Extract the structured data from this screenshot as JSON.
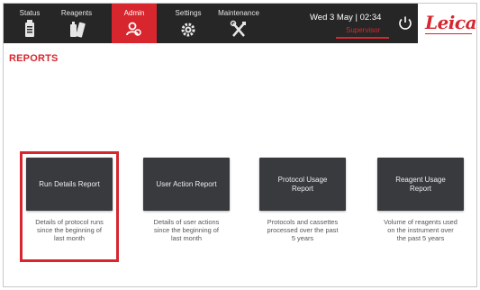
{
  "nav": {
    "tabs": [
      {
        "label": "Status",
        "icon": "status-bottle-icon"
      },
      {
        "label": "Reagents",
        "icon": "reagent-bottles-icon"
      },
      {
        "label": "Admin",
        "icon": "admin-users-icon"
      },
      {
        "label": "Settings",
        "icon": "gear-icon"
      },
      {
        "label": "Maintenance",
        "icon": "tools-icon"
      }
    ],
    "active_tab": "Admin",
    "datetime": "Wed 3 May | 02:34",
    "user_role": "Supervisor",
    "power_icon": "power-icon",
    "logo": "Leica"
  },
  "page": {
    "title": "REPORTS"
  },
  "reports": [
    {
      "button": "Run Details Report",
      "description": "Details of protocol runs since the beginning of last month"
    },
    {
      "button": "User Action Report",
      "description": "Details of user actions since the beginning of last month"
    },
    {
      "button": "Protocol Usage Report",
      "description": "Protocols and cassettes processed over the past 5 years"
    },
    {
      "button": "Reagent Usage Report",
      "description": "Volume of reagents used on the instrument over the past 5 years"
    }
  ],
  "colors": {
    "accent": "#d7262e",
    "topbar": "#262626",
    "button": "#383a3d"
  }
}
